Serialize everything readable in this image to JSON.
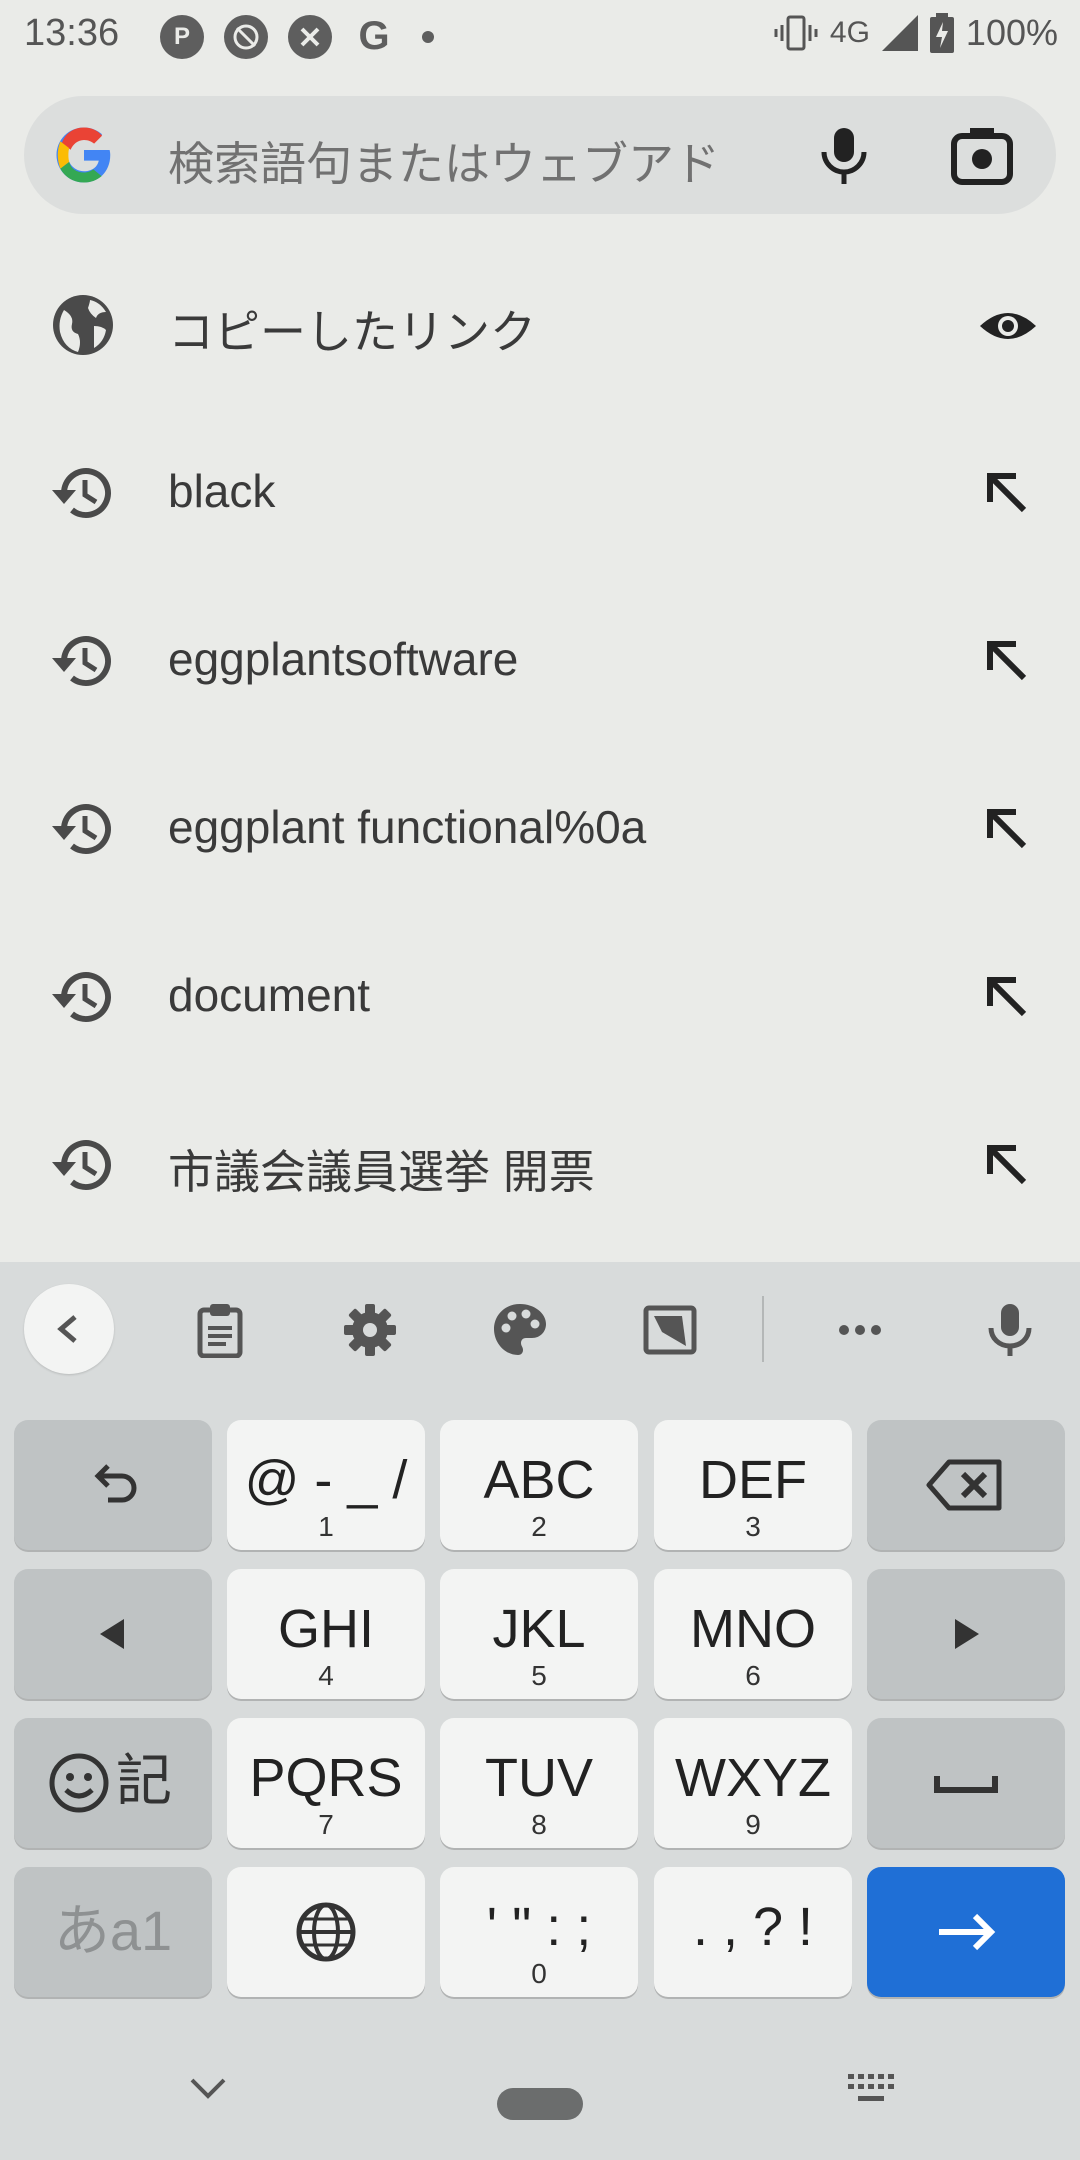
{
  "status_bar": {
    "time": "13:36",
    "network": "4G",
    "battery": "100%",
    "left_icons": [
      "pinterest-icon",
      "no-location-icon",
      "x-circle-icon",
      "google-icon",
      "dot-icon"
    ]
  },
  "search": {
    "placeholder": "検索語句またはウェブアド",
    "icons": [
      "google-logo-icon",
      "mic-icon",
      "camera-icon"
    ]
  },
  "suggestions": [
    {
      "label": "コピーしたリンク",
      "lead_icon": "globe-icon",
      "trail_icon": "eye-icon"
    },
    {
      "label": "black",
      "lead_icon": "history-icon",
      "trail_icon": "arrow-up-left-icon"
    },
    {
      "label": "eggplantsoftware",
      "lead_icon": "history-icon",
      "trail_icon": "arrow-up-left-icon"
    },
    {
      "label": "eggplant functional%0a",
      "lead_icon": "history-icon",
      "trail_icon": "arrow-up-left-icon"
    },
    {
      "label": "document",
      "lead_icon": "history-icon",
      "trail_icon": "arrow-up-left-icon"
    },
    {
      "label": "市議会議員選挙 開票",
      "lead_icon": "history-icon",
      "trail_icon": "arrow-up-left-icon"
    }
  ],
  "keyboard": {
    "toolbar": [
      "chevron-left-icon",
      "clipboard-icon",
      "gear-icon",
      "palette-icon",
      "crop-icon",
      "more-icon",
      "mic-icon"
    ],
    "rows": [
      [
        {
          "icon": "undo-icon"
        },
        {
          "main": "@ - _ /",
          "sub": "1"
        },
        {
          "main": "ABC",
          "sub": "2"
        },
        {
          "main": "DEF",
          "sub": "3"
        },
        {
          "icon": "backspace-icon"
        }
      ],
      [
        {
          "icon": "left-arrow-icon"
        },
        {
          "main": "GHI",
          "sub": "4"
        },
        {
          "main": "JKL",
          "sub": "5"
        },
        {
          "main": "MNO",
          "sub": "6"
        },
        {
          "icon": "right-arrow-icon"
        }
      ],
      [
        {
          "main": "記",
          "icon": "emoji-icon"
        },
        {
          "main": "PQRS",
          "sub": "7"
        },
        {
          "main": "TUV",
          "sub": "8"
        },
        {
          "main": "WXYZ",
          "sub": "9"
        },
        {
          "icon": "space-icon"
        }
      ],
      [
        {
          "main": "あa1"
        },
        {
          "icon": "globe-icon"
        },
        {
          "main": "' \" : ;",
          "sub": "0"
        },
        {
          "main": ". , ? !"
        },
        {
          "icon": "enter-arrow-icon"
        }
      ]
    ],
    "accent_color": "#1f6fd6"
  },
  "nav_bar": [
    "chevron-down-icon",
    "home-pill",
    "keyboard-icon"
  ]
}
